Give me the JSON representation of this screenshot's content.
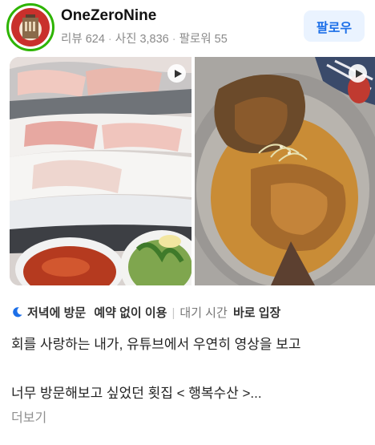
{
  "profile": {
    "name": "OneZeroNine",
    "stats": [
      "리뷰 624",
      "사진 3,836",
      "팔로워 55"
    ],
    "follow_label": "팔로우",
    "avatar_icon": "restaurant-building-icon"
  },
  "media": {
    "items": [
      {
        "kind": "video",
        "subject": "sashimi-platter",
        "icon": "play-icon"
      },
      {
        "kind": "video",
        "subject": "braised-fish-head",
        "icon": "play-icon"
      }
    ]
  },
  "visit_info": {
    "icon": "moon-icon",
    "visit_time": "저녁에 방문",
    "reservation": "예약 없이 이용",
    "wait_label": "대기 시간",
    "wait_value": "바로 입장"
  },
  "review": {
    "line1": "회를 사랑하는 내가, 유튜브에서 우연히 영상을 보고",
    "line2": "너무 방문해보고 싶었던 횟집 < 행복수산 >...",
    "more_label": "더보기"
  },
  "colors": {
    "accent_blue": "#1c6fe8",
    "follow_bg": "#eaf3ff",
    "avatar_ring": "#2db400",
    "muted_text": "#8a8a8a"
  }
}
